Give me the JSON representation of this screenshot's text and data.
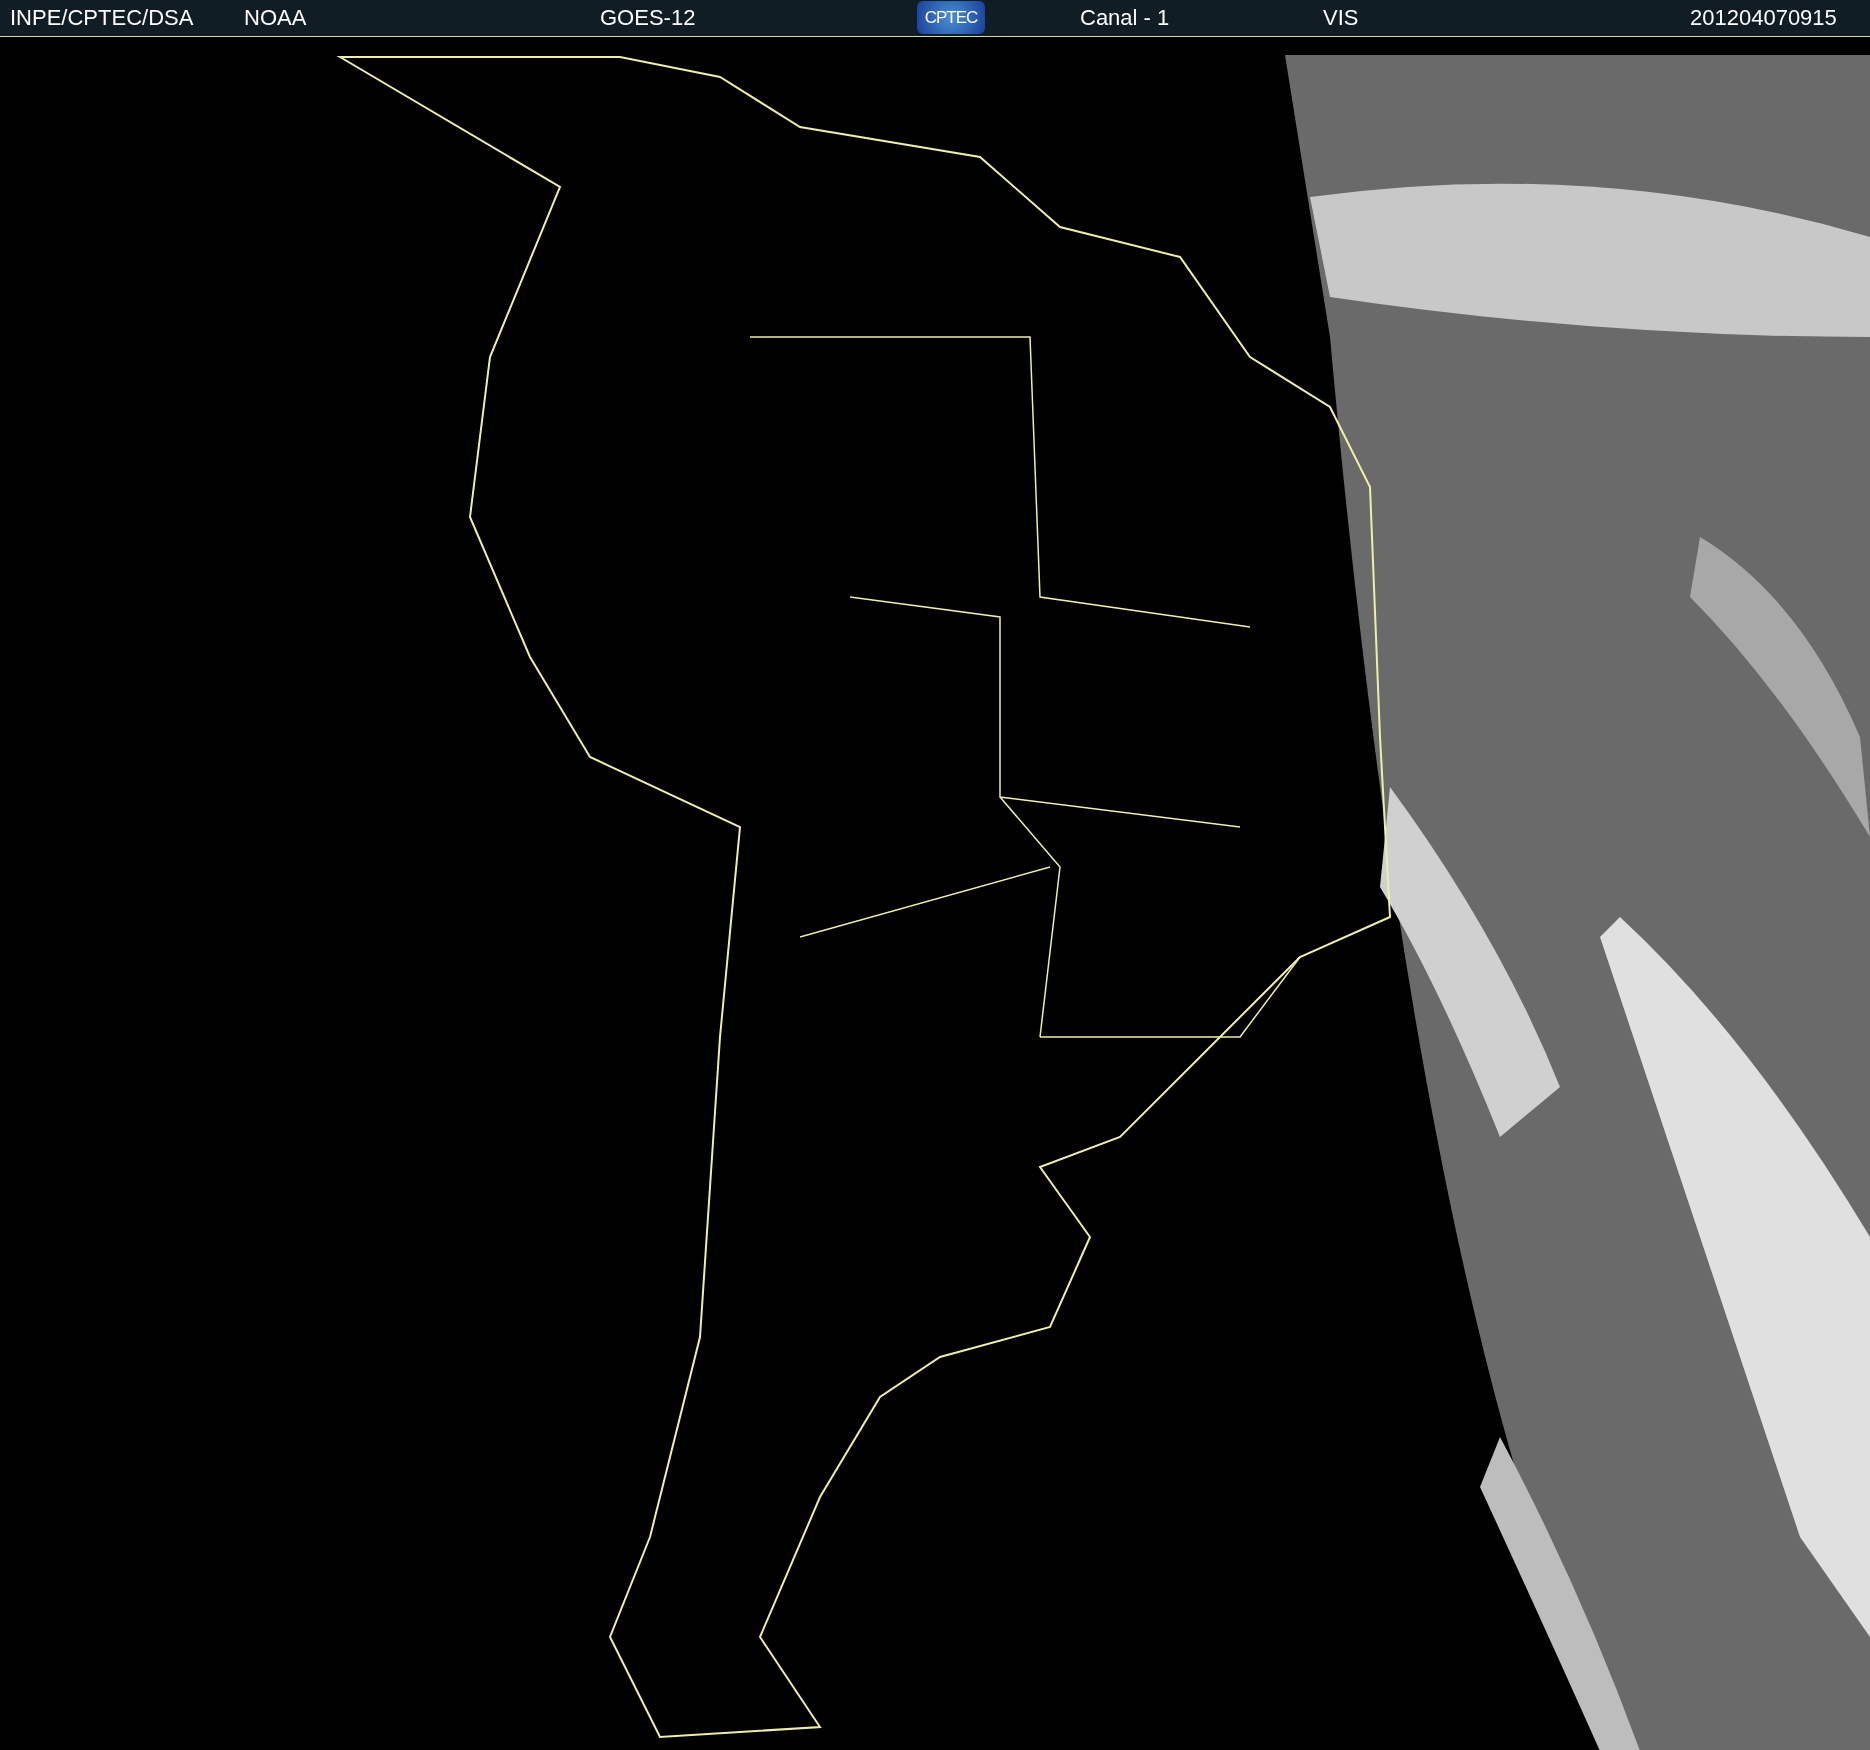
{
  "header": {
    "source": "INPE/CPTEC/DSA",
    "agency": "NOAA",
    "satellite": "GOES-12",
    "logo": "CPTEC",
    "channel": "Canal - 1",
    "band": "VIS",
    "timestamp": "201204070915"
  }
}
